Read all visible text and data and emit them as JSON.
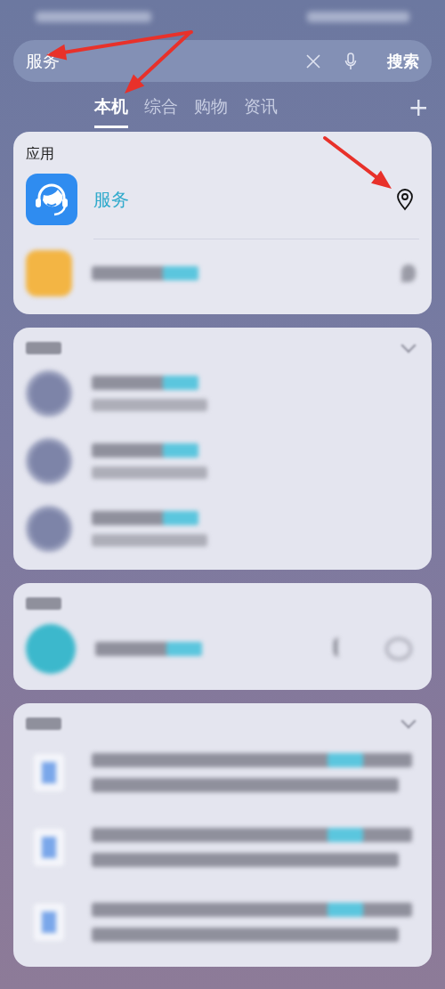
{
  "search": {
    "value": "服务",
    "button": "搜索"
  },
  "tabs": [
    {
      "label": "本机",
      "selected": true
    },
    {
      "label": "综合",
      "selected": false
    },
    {
      "label": "购物",
      "selected": false
    },
    {
      "label": "资讯",
      "selected": false
    }
  ],
  "add_tab": "+",
  "apps_section": {
    "title": "应用",
    "items": [
      {
        "name": "服务"
      }
    ],
    "blurred_rows": [
      {
        "kind": "app"
      }
    ]
  },
  "blurred_cards": [
    {
      "chevron": true,
      "rows": [
        {
          "kind": "setting"
        },
        {
          "kind": "setting"
        },
        {
          "kind": "setting"
        }
      ]
    },
    {
      "chevron": false,
      "rows": [
        {
          "kind": "contact"
        }
      ]
    },
    {
      "chevron": true,
      "rows": [
        {
          "kind": "file"
        },
        {
          "kind": "file"
        },
        {
          "kind": "file"
        }
      ]
    }
  ],
  "annotations": [
    {
      "kind": "arrow"
    },
    {
      "kind": "arrow"
    },
    {
      "kind": "arrow"
    }
  ]
}
